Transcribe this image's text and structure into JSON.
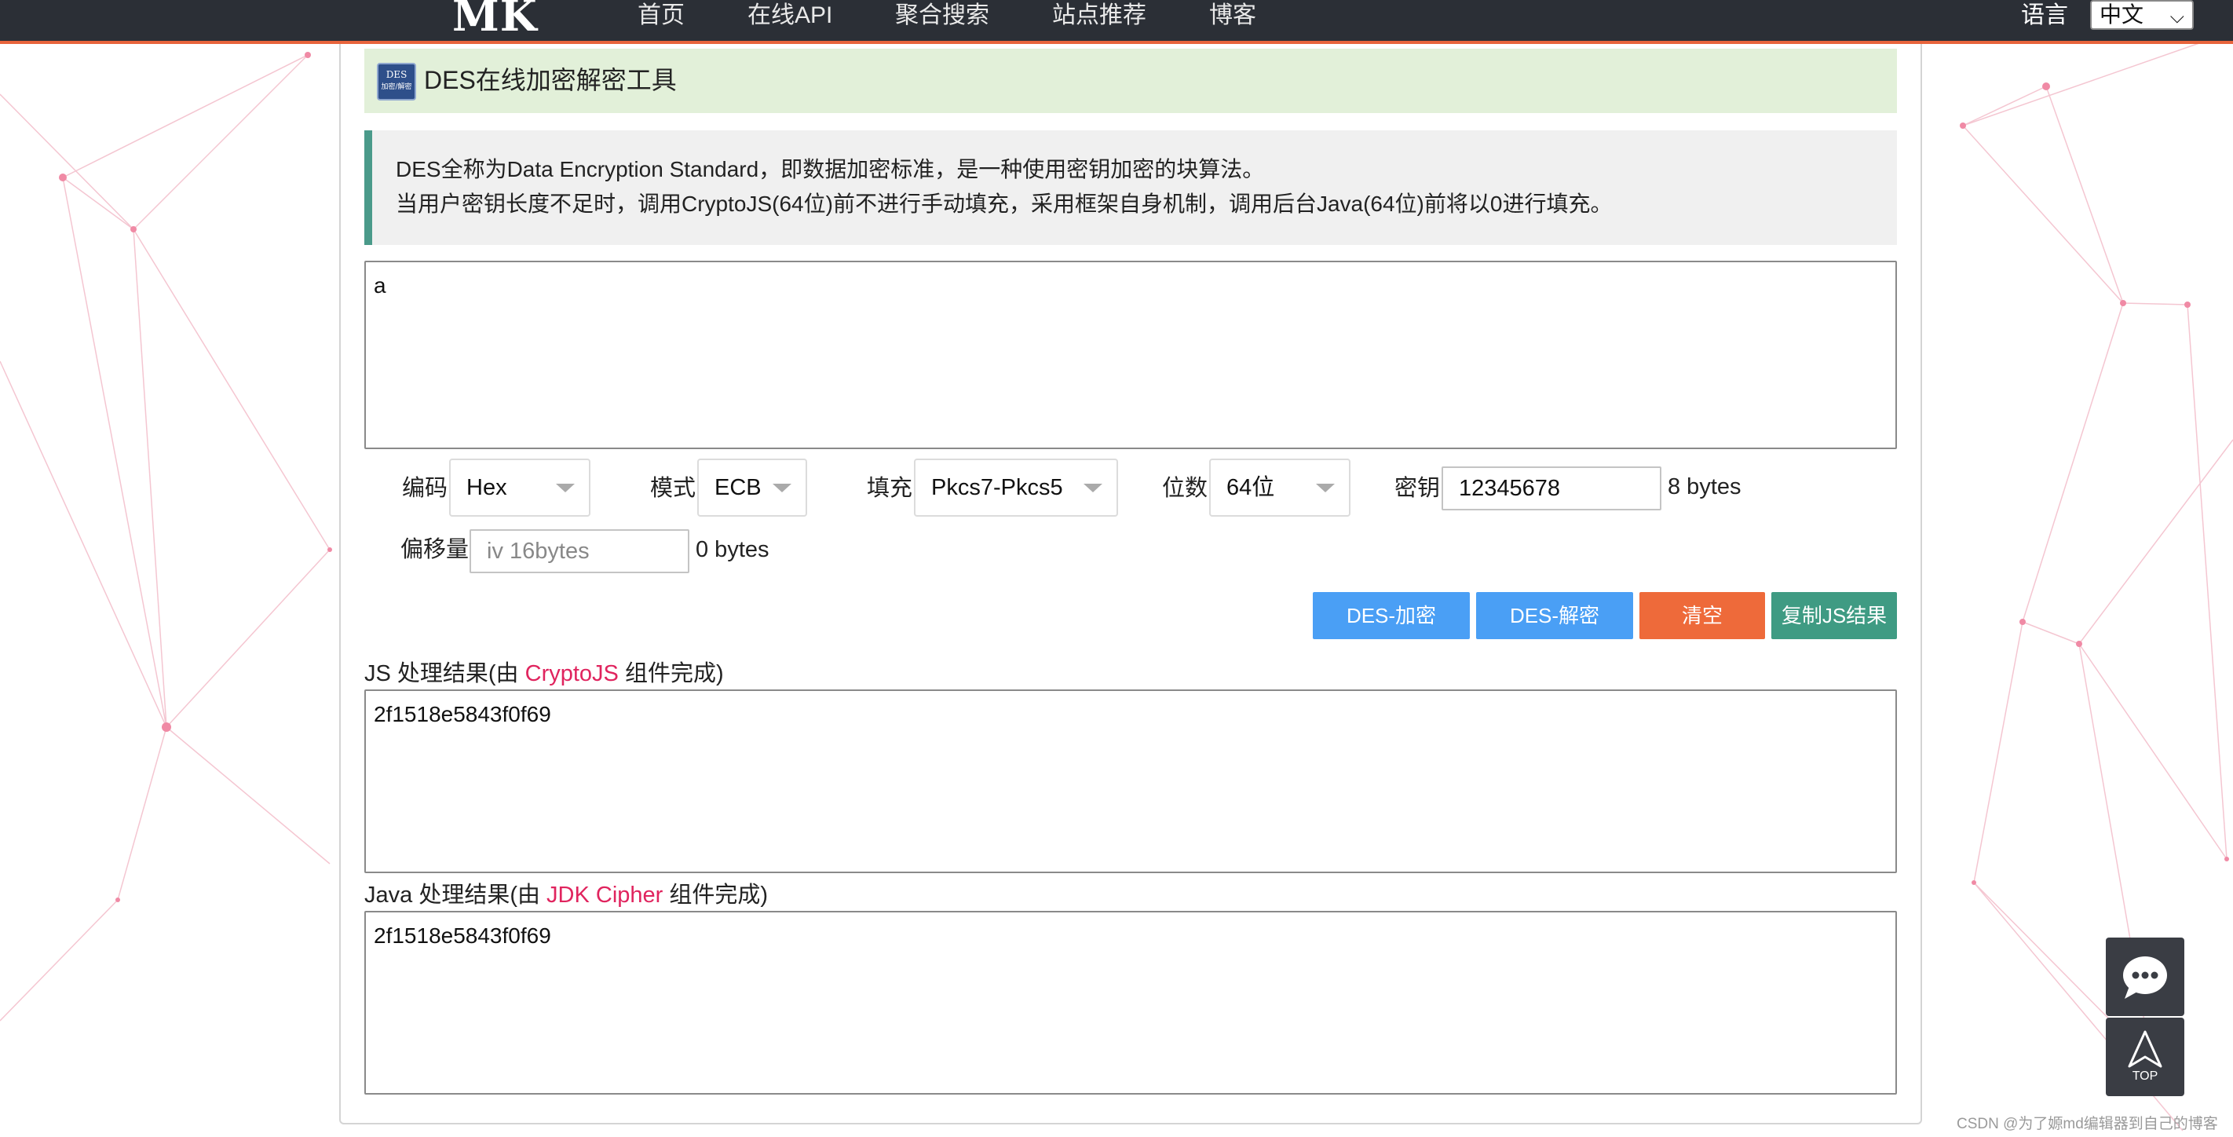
{
  "nav": {
    "logo": "MK",
    "items": [
      "首页",
      "在线API",
      "聚合搜索",
      "站点推荐",
      "博客"
    ],
    "lang_label": "语言",
    "lang_value": "中文"
  },
  "tool": {
    "title": "DES在线加密解密工具",
    "icon_line1": "DES",
    "icon_line2": "加密/解密",
    "info_line1": "DES全称为Data Encryption Standard，即数据加密标准，是一种使用密钥加密的块算法。",
    "info_line2": "当用户密钥长度不足时，调用CryptoJS(64位)前不进行手动填充，采用框架自身机制，调用后台Java(64位)前将以0进行填充。",
    "input_text": "a"
  },
  "options": {
    "encoding_label": "编码",
    "encoding_value": "Hex",
    "mode_label": "模式",
    "mode_value": "ECB",
    "padding_label": "填充",
    "padding_value": "Pkcs7-Pkcs5",
    "bits_label": "位数",
    "bits_value": "64位",
    "key_label": "密钥",
    "key_value": "12345678",
    "key_bytes": "8 bytes",
    "iv_label": "偏移量",
    "iv_placeholder": "iv 16bytes",
    "iv_bytes": "0 bytes"
  },
  "buttons": {
    "encrypt": "DES-加密",
    "decrypt": "DES-解密",
    "clear": "清空",
    "copy": "复制JS结果"
  },
  "results": {
    "js_prefix": "JS 处理结果(由 ",
    "js_lib": "CryptoJS",
    "js_suffix": " 组件完成)",
    "js_output": "2f1518e5843f0f69",
    "java_prefix": "Java 处理结果(由 ",
    "java_lib": "JDK Cipher",
    "java_suffix": " 组件完成)",
    "java_output": "2f1518e5843f0f69"
  },
  "floating": {
    "top_label": "TOP"
  },
  "watermark": "CSDN @为了嫄md编辑器到自己的博客",
  "colors": {
    "nav_bg": "#2b2f36",
    "nav_accent": "#e8643c",
    "title_bg": "#e2f0d9",
    "info_border": "#4a9a8a",
    "btn_blue": "#4a9ff5",
    "btn_orange": "#ee6a3a",
    "btn_green": "#3f9b83",
    "highlight": "#e0245e"
  }
}
